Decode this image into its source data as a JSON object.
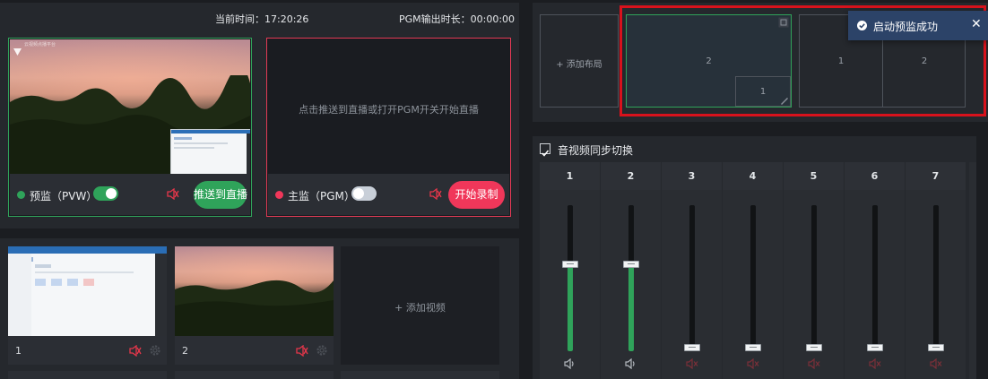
{
  "header": {
    "time_label": "当前时间：17:20:26",
    "pgm_label": "PGM输出时长：00:00:00"
  },
  "pvw": {
    "label": "预监（PVW）",
    "toggle_on": true,
    "push_button": "推送到直播",
    "overlay_text": "云视频点播平台"
  },
  "pgm": {
    "label": "主监（PGM）",
    "toggle_on": false,
    "placeholder": "点击推送到直播或打开PGM开关开始直播",
    "record_button": "开始录制"
  },
  "videos": {
    "items": [
      {
        "number": "1"
      },
      {
        "number": "2"
      }
    ],
    "add_label": "+ 添加视频"
  },
  "layouts": {
    "add_label": "+ 添加布局",
    "layout1_main": "2",
    "layout1_pip": "1",
    "layout2_left": "1",
    "layout2_right": "2"
  },
  "toast": {
    "message": "启动预监成功"
  },
  "mixer": {
    "sync_label": "音视频同步切换",
    "sync_checked": true,
    "channels": [
      {
        "label": "1",
        "level": 0.6,
        "active": true
      },
      {
        "label": "2",
        "level": 0.6,
        "active": true
      },
      {
        "label": "3",
        "level": 0.0,
        "active": false
      },
      {
        "label": "4",
        "level": 0.0,
        "active": false
      },
      {
        "label": "5",
        "level": 0.0,
        "active": false
      },
      {
        "label": "6",
        "level": 0.0,
        "active": false
      },
      {
        "label": "7",
        "level": 0.0,
        "active": false
      }
    ]
  },
  "colors": {
    "accent_green": "#2fa35a",
    "accent_red": "#f0375a",
    "highlight_red": "#d8121c",
    "toast_blue": "#2c4368"
  }
}
